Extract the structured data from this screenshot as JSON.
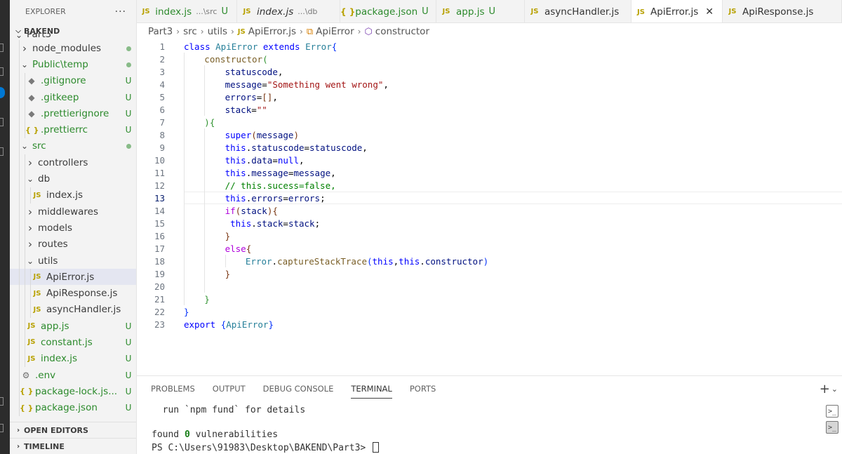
{
  "explorer": {
    "title": "EXPLORER",
    "more": "···",
    "root": "BAKEND",
    "tree": [
      {
        "name": "Part3",
        "kind": "folder",
        "depth": 0,
        "open": true,
        "partial": true
      },
      {
        "name": "node_modules",
        "kind": "folder",
        "depth": 1,
        "open": false,
        "dot": true
      },
      {
        "name": "Public\\temp",
        "kind": "folder",
        "depth": 1,
        "open": true,
        "dot": true,
        "green": true
      },
      {
        "name": ".gitignore",
        "kind": "git",
        "depth": 2,
        "badge": "U",
        "green": true
      },
      {
        "name": ".gitkeep",
        "kind": "git",
        "depth": 2,
        "badge": "U",
        "green": true
      },
      {
        "name": ".prettierignore",
        "kind": "git",
        "depth": 2,
        "badge": "U",
        "green": true
      },
      {
        "name": ".prettierrc",
        "kind": "json",
        "depth": 2,
        "badge": "U",
        "green": true
      },
      {
        "name": "src",
        "kind": "folder",
        "depth": 1,
        "open": true,
        "dot": true,
        "green": true
      },
      {
        "name": "controllers",
        "kind": "folder",
        "depth": 2,
        "open": false
      },
      {
        "name": "db",
        "kind": "folder",
        "depth": 2,
        "open": true
      },
      {
        "name": "index.js",
        "kind": "js",
        "depth": 3
      },
      {
        "name": "middlewares",
        "kind": "folder",
        "depth": 2,
        "open": false
      },
      {
        "name": "models",
        "kind": "folder",
        "depth": 2,
        "open": false
      },
      {
        "name": "routes",
        "kind": "folder",
        "depth": 2,
        "open": false
      },
      {
        "name": "utils",
        "kind": "folder",
        "depth": 2,
        "open": true
      },
      {
        "name": "ApiError.js",
        "kind": "js",
        "depth": 3,
        "selected": true
      },
      {
        "name": "ApiResponse.js",
        "kind": "js",
        "depth": 3
      },
      {
        "name": "asyncHandler.js",
        "kind": "js",
        "depth": 3
      },
      {
        "name": "app.js",
        "kind": "js",
        "depth": 2,
        "badge": "U",
        "green": true
      },
      {
        "name": "constant.js",
        "kind": "js",
        "depth": 2,
        "badge": "U",
        "green": true
      },
      {
        "name": "index.js",
        "kind": "js",
        "depth": 2,
        "badge": "U",
        "green": true
      },
      {
        "name": ".env",
        "kind": "env",
        "depth": 1,
        "badge": "U",
        "green": true
      },
      {
        "name": "package-lock.js...",
        "kind": "json",
        "depth": 1,
        "badge": "U",
        "green": true
      },
      {
        "name": "package.json",
        "kind": "json",
        "depth": 1,
        "badge": "U",
        "green": true
      }
    ],
    "sections": [
      "OPEN EDITORS",
      "TIMELINE"
    ]
  },
  "tabs": [
    {
      "icon": "JS",
      "label": "index.js",
      "desc": "...\\src",
      "badge": "U",
      "green": true,
      "width": 143
    },
    {
      "icon": "JS",
      "label": "index.js",
      "desc": "...\\db",
      "italic": true,
      "width": 147
    },
    {
      "icon": "{ }",
      "label": "package.json",
      "badge": "U",
      "green": true,
      "json": true,
      "width": 137
    },
    {
      "icon": "JS",
      "label": "app.js",
      "badge": "U",
      "green": true,
      "width": 126
    },
    {
      "icon": "JS",
      "label": "asyncHandler.js",
      "width": 152
    },
    {
      "icon": "JS",
      "label": "ApiError.js",
      "active": true,
      "close": "✕",
      "width": 130
    },
    {
      "icon": "JS",
      "label": "ApiResponse.js",
      "width": 170
    }
  ],
  "breadcrumb": {
    "parts": [
      "Part3",
      "src",
      "utils"
    ],
    "file": "ApiError.js",
    "file_icon": "JS",
    "symbol_class": "ApiError",
    "symbol_member": "constructor"
  },
  "editor": {
    "current_line": 13,
    "lines": [
      {
        "n": "1",
        "indent": 0,
        "tokens": [
          [
            "kw",
            "class "
          ],
          [
            "cls",
            "ApiError "
          ],
          [
            "kw",
            "extends "
          ],
          [
            "cls",
            "Error"
          ],
          [
            "br1",
            "{"
          ]
        ]
      },
      {
        "n": "2",
        "indent": 1,
        "tokens": [
          [
            "fn",
            "constructor"
          ],
          [
            "br2",
            "("
          ]
        ]
      },
      {
        "n": "3",
        "indent": 2,
        "tokens": [
          [
            "var",
            "statuscode"
          ],
          [
            "pun",
            ","
          ]
        ]
      },
      {
        "n": "4",
        "indent": 2,
        "tokens": [
          [
            "var",
            "message"
          ],
          [
            "pun",
            "="
          ],
          [
            "str",
            "\"Something went wrong\""
          ],
          [
            "pun",
            ","
          ]
        ]
      },
      {
        "n": "5",
        "indent": 2,
        "tokens": [
          [
            "var",
            "errors"
          ],
          [
            "pun",
            "="
          ],
          [
            "br3",
            "[]"
          ],
          [
            "pun",
            ","
          ]
        ]
      },
      {
        "n": "6",
        "indent": 2,
        "tokens": [
          [
            "var",
            "stack"
          ],
          [
            "pun",
            "="
          ],
          [
            "str",
            "\"\""
          ]
        ]
      },
      {
        "n": "7",
        "indent": 1,
        "tokens": [
          [
            "br2",
            ")"
          ],
          [
            "br2",
            "{"
          ]
        ]
      },
      {
        "n": "8",
        "indent": 2,
        "tokens": [
          [
            "kw",
            "super"
          ],
          [
            "br3",
            "("
          ],
          [
            "var",
            "message"
          ],
          [
            "br3",
            ")"
          ]
        ]
      },
      {
        "n": "9",
        "indent": 2,
        "tokens": [
          [
            "kw",
            "this"
          ],
          [
            "pun",
            "."
          ],
          [
            "var",
            "statuscode"
          ],
          [
            "pun",
            "="
          ],
          [
            "var",
            "statuscode"
          ],
          [
            "pun",
            ","
          ]
        ]
      },
      {
        "n": "10",
        "indent": 2,
        "tokens": [
          [
            "kw",
            "this"
          ],
          [
            "pun",
            "."
          ],
          [
            "var",
            "data"
          ],
          [
            "pun",
            "="
          ],
          [
            "kw",
            "null"
          ],
          [
            "pun",
            ","
          ]
        ]
      },
      {
        "n": "11",
        "indent": 2,
        "tokens": [
          [
            "kw",
            "this"
          ],
          [
            "pun",
            "."
          ],
          [
            "var",
            "message"
          ],
          [
            "pun",
            "="
          ],
          [
            "var",
            "message"
          ],
          [
            "pun",
            ","
          ]
        ]
      },
      {
        "n": "12",
        "indent": 2,
        "tokens": [
          [
            "cmt",
            "// this.sucess=false,"
          ]
        ]
      },
      {
        "n": "13",
        "indent": 2,
        "tokens": [
          [
            "kw",
            "this"
          ],
          [
            "pun",
            "."
          ],
          [
            "var",
            "errors"
          ],
          [
            "pun",
            "="
          ],
          [
            "var",
            "errors"
          ],
          [
            "pun",
            ";"
          ]
        ]
      },
      {
        "n": "14",
        "indent": 2,
        "tokens": [
          [
            "ctl",
            "if"
          ],
          [
            "br3",
            "("
          ],
          [
            "var",
            "stack"
          ],
          [
            "br3",
            ")"
          ],
          [
            "br3",
            "{"
          ]
        ]
      },
      {
        "n": "15",
        "indent": 2,
        "tokens": [
          [
            "pun",
            " "
          ],
          [
            "kw",
            "this"
          ],
          [
            "pun",
            "."
          ],
          [
            "var",
            "stack"
          ],
          [
            "pun",
            "="
          ],
          [
            "var",
            "stack"
          ],
          [
            "pun",
            ";"
          ]
        ]
      },
      {
        "n": "16",
        "indent": 2,
        "tokens": [
          [
            "br3",
            "}"
          ]
        ]
      },
      {
        "n": "17",
        "indent": 2,
        "tokens": [
          [
            "ctl",
            "else"
          ],
          [
            "br3",
            "{"
          ]
        ]
      },
      {
        "n": "18",
        "indent": 3,
        "tokens": [
          [
            "cls",
            "Error"
          ],
          [
            "pun",
            "."
          ],
          [
            "fn",
            "captureStackTrace"
          ],
          [
            "br1",
            "("
          ],
          [
            "kw",
            "this"
          ],
          [
            "pun",
            ","
          ],
          [
            "kw",
            "this"
          ],
          [
            "pun",
            "."
          ],
          [
            "var",
            "constructor"
          ],
          [
            "br1",
            ")"
          ]
        ]
      },
      {
        "n": "19",
        "indent": 2,
        "tokens": [
          [
            "br3",
            "}"
          ]
        ]
      },
      {
        "n": "20",
        "indent": 0,
        "tokens": []
      },
      {
        "n": "21",
        "indent": 1,
        "tokens": [
          [
            "br2",
            "}"
          ]
        ]
      },
      {
        "n": "22",
        "indent": 0,
        "tokens": [
          [
            "br1",
            "}"
          ]
        ]
      },
      {
        "n": "23",
        "indent": 0,
        "tokens": [
          [
            "kw",
            "export "
          ],
          [
            "br1",
            "{"
          ],
          [
            "cls",
            "ApiError"
          ],
          [
            "br1",
            "}"
          ]
        ]
      }
    ]
  },
  "panel": {
    "tabs": [
      "PROBLEMS",
      "OUTPUT",
      "DEBUG CONSOLE",
      "TERMINAL",
      "PORTS"
    ],
    "active_tab": "TERMINAL",
    "add": "+",
    "terminal": {
      "line1": "  run `npm fund` for details",
      "line2": "",
      "line3_pre": "found ",
      "line3_num": "0",
      "line3_post": " vulnerabilities",
      "prompt": "PS C:\\Users\\91983\\Desktop\\BAKEND\\Part3> "
    }
  },
  "colors": {
    "accent": "#0078d4",
    "git_untracked": "#2c8a2c",
    "js_icon": "#b8a100"
  }
}
